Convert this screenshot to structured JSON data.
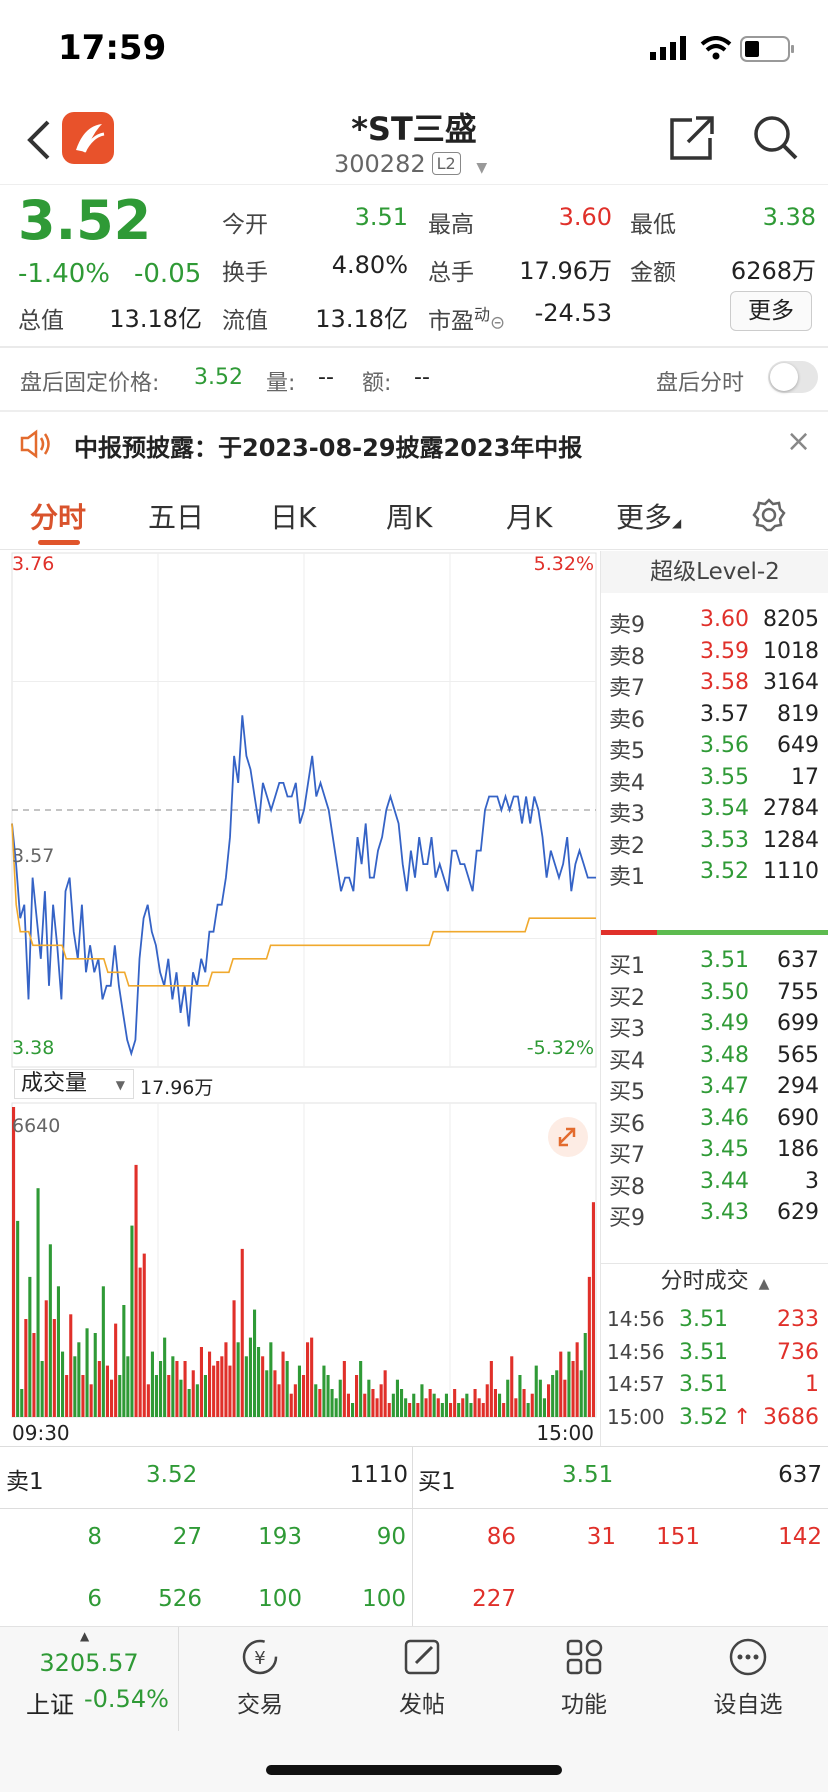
{
  "status_bar": {
    "time": "17:59"
  },
  "header": {
    "title": "*ST三盛",
    "code": "300282",
    "level_badge": "L2"
  },
  "quote": {
    "price": "3.52",
    "change_pct": "-1.40%",
    "change": "-0.05",
    "open_label": "今开",
    "open": "3.51",
    "high_label": "最高",
    "high": "3.60",
    "low_label": "最低",
    "low": "3.38",
    "turnover_label": "换手",
    "turnover": "4.80%",
    "volume_label": "总手",
    "volume": "17.96万",
    "amount_label": "金额",
    "amount": "6268万",
    "mcap_label": "总值",
    "mcap": "13.18亿",
    "float_label": "流值",
    "float": "13.18亿",
    "pe_label": "市盈",
    "pe_sup": "动",
    "pe": "-24.53",
    "more_button": "更多"
  },
  "after_hours": {
    "label": "盘后固定价格:",
    "price": "3.52",
    "vol_label": "量:",
    "vol": "--",
    "amt_label": "额:",
    "amt": "--",
    "toggle_label": "盘后分时"
  },
  "notice": {
    "text": "中报预披露：于2023-08-29披露2023年中报"
  },
  "tabs": [
    "分时",
    "五日",
    "日K",
    "周K",
    "月K",
    "更多"
  ],
  "chart_labels": {
    "y_max": "3.76",
    "y_min": "3.38",
    "pct_max": "5.32%",
    "pct_min": "-5.32%",
    "prev_close": "3.57",
    "volume_selector": "成交量",
    "volume_total": "17.96万",
    "vol_max": "6640",
    "time_start": "09:30",
    "time_end": "15:00"
  },
  "chart_data": {
    "type": "line",
    "title": "",
    "xlabel": "",
    "ylabel": "",
    "x_range": [
      "09:30",
      "15:00"
    ],
    "ylim": [
      3.38,
      3.76
    ],
    "reference_line": 3.57,
    "series": [
      {
        "values": [
          3.56,
          3.53,
          3.49,
          3.5,
          3.43,
          3.52,
          3.49,
          3.46,
          3.51,
          3.44,
          3.5,
          3.47,
          3.43,
          3.51,
          3.52,
          3.48,
          3.46,
          3.5,
          3.45,
          3.47,
          3.45,
          3.46,
          3.43,
          3.44,
          3.44,
          3.47,
          3.44,
          3.42,
          3.4,
          3.39,
          3.4,
          3.46,
          3.49,
          3.5,
          3.48,
          3.47,
          3.45,
          3.44,
          3.46,
          3.43,
          3.45,
          3.42,
          3.44,
          3.41,
          3.45,
          3.44,
          3.46,
          3.45,
          3.48,
          3.48,
          3.5,
          3.5,
          3.52,
          3.55,
          3.61,
          3.59,
          3.64,
          3.61,
          3.6,
          3.58,
          3.56,
          3.59,
          3.58,
          3.57,
          3.58,
          3.59,
          3.59,
          3.58,
          3.58,
          3.59,
          3.56,
          3.57,
          3.59,
          3.61,
          3.58,
          3.59,
          3.58,
          3.57,
          3.55,
          3.53,
          3.51,
          3.52,
          3.52,
          3.51,
          3.55,
          3.53,
          3.56,
          3.52,
          3.52,
          3.54,
          3.55,
          3.57,
          3.58,
          3.57,
          3.56,
          3.53,
          3.51,
          3.54,
          3.52,
          3.55,
          3.53,
          3.53,
          3.55,
          3.52,
          3.53,
          3.52,
          3.51,
          3.54,
          3.54,
          3.53,
          3.53,
          3.52,
          3.51,
          3.54,
          3.54,
          3.57,
          3.58,
          3.58,
          3.58,
          3.57,
          3.58,
          3.57,
          3.58,
          3.58,
          3.56,
          3.58,
          3.56,
          3.58,
          3.57,
          3.55,
          3.52,
          3.54,
          3.53,
          3.52,
          3.53,
          3.55,
          3.51,
          3.53,
          3.54,
          3.53,
          3.52,
          3.52,
          3.52
        ]
      },
      {
        "values": [
          3.56,
          3.5,
          3.48,
          3.48,
          3.48,
          3.47,
          3.47,
          3.47,
          3.47,
          3.47,
          3.47,
          3.47,
          3.47,
          3.46,
          3.46,
          3.46,
          3.46,
          3.46,
          3.46,
          3.46,
          3.46,
          3.46,
          3.46,
          3.45,
          3.45,
          3.45,
          3.45,
          3.45,
          3.44,
          3.44,
          3.44,
          3.44,
          3.44,
          3.44,
          3.44,
          3.44,
          3.44,
          3.44,
          3.44,
          3.44,
          3.44,
          3.44,
          3.44,
          3.44,
          3.44,
          3.44,
          3.44,
          3.44,
          3.45,
          3.45,
          3.45,
          3.45,
          3.45,
          3.46,
          3.46,
          3.46,
          3.46,
          3.46,
          3.46,
          3.46,
          3.46,
          3.46,
          3.47,
          3.47,
          3.47,
          3.47,
          3.47,
          3.47,
          3.47,
          3.47,
          3.47,
          3.47,
          3.47,
          3.47,
          3.47,
          3.47,
          3.47,
          3.47,
          3.47,
          3.47,
          3.47,
          3.47,
          3.47,
          3.47,
          3.47,
          3.47,
          3.47,
          3.47,
          3.47,
          3.47,
          3.47,
          3.47,
          3.47,
          3.47,
          3.47,
          3.47,
          3.47,
          3.47,
          3.47,
          3.47,
          3.47,
          3.48,
          3.48,
          3.48,
          3.48,
          3.48,
          3.48,
          3.48,
          3.48,
          3.48,
          3.48,
          3.48,
          3.48,
          3.48,
          3.48,
          3.48,
          3.48,
          3.48,
          3.48,
          3.48,
          3.48,
          3.48,
          3.48,
          3.48,
          3.49,
          3.49,
          3.49,
          3.49,
          3.49,
          3.49,
          3.49,
          3.49,
          3.49,
          3.49,
          3.49,
          3.49,
          3.49,
          3.49,
          3.49,
          3.49,
          3.49
        ]
      }
    ],
    "volume": [
      6640,
      4200,
      600,
      2100,
      3000,
      1800,
      4900,
      1200,
      2500,
      3700,
      2100,
      2800,
      1400,
      900,
      2200,
      1300,
      1600,
      900,
      1900,
      700,
      1800,
      1200,
      2800,
      1100,
      800,
      2000,
      900,
      2400,
      1300,
      4100,
      5400,
      3200,
      3500,
      700,
      1400,
      900,
      1200,
      1700,
      900,
      1300,
      1200,
      800,
      1200,
      600,
      1000,
      700,
      1500,
      900,
      1400,
      1100,
      1200,
      1300,
      1600,
      1100,
      2500,
      1600,
      3600,
      1300,
      1700,
      2300,
      1500,
      1300,
      1000,
      1600,
      1000,
      700,
      1400,
      1200,
      500,
      700,
      1100,
      900,
      1600,
      1700,
      700,
      600,
      1100,
      900,
      600,
      400,
      800,
      1200,
      500,
      300,
      900,
      1200,
      500,
      800,
      600,
      400,
      700,
      1000,
      300,
      500,
      800,
      600,
      400,
      300,
      500,
      300,
      700,
      400,
      600,
      500,
      400,
      300,
      500,
      300,
      600,
      300,
      400,
      500,
      300,
      600,
      400,
      300,
      700,
      1200,
      600,
      500,
      300,
      800,
      1300,
      400,
      900,
      600,
      300,
      500,
      1100,
      800,
      400,
      700,
      900,
      1000,
      1400,
      800,
      1400,
      1200,
      1600,
      1000,
      1800,
      3000,
      4600
    ]
  },
  "order_book": {
    "title": "超级Level-2",
    "asks": [
      {
        "label": "卖9",
        "price": "3.60",
        "qty": "8205"
      },
      {
        "label": "卖8",
        "price": "3.59",
        "qty": "1018"
      },
      {
        "label": "卖7",
        "price": "3.58",
        "qty": "3164"
      },
      {
        "label": "卖6",
        "price": "3.57",
        "qty": "819"
      },
      {
        "label": "卖5",
        "price": "3.56",
        "qty": "649"
      },
      {
        "label": "卖4",
        "price": "3.55",
        "qty": "17"
      },
      {
        "label": "卖3",
        "price": "3.54",
        "qty": "2784"
      },
      {
        "label": "卖2",
        "price": "3.53",
        "qty": "1284"
      },
      {
        "label": "卖1",
        "price": "3.52",
        "qty": "1110"
      }
    ],
    "bids": [
      {
        "label": "买1",
        "price": "3.51",
        "qty": "637"
      },
      {
        "label": "买2",
        "price": "3.50",
        "qty": "755"
      },
      {
        "label": "买3",
        "price": "3.49",
        "qty": "699"
      },
      {
        "label": "买4",
        "price": "3.48",
        "qty": "565"
      },
      {
        "label": "买5",
        "price": "3.47",
        "qty": "294"
      },
      {
        "label": "买6",
        "price": "3.46",
        "qty": "690"
      },
      {
        "label": "买7",
        "price": "3.45",
        "qty": "186"
      },
      {
        "label": "买8",
        "price": "3.44",
        "qty": "3"
      },
      {
        "label": "买9",
        "price": "3.43",
        "qty": "629"
      }
    ],
    "trades_title": "分时成交",
    "trades": [
      {
        "time": "14:56",
        "price": "3.51",
        "qty": "233"
      },
      {
        "time": "14:56",
        "price": "3.51",
        "qty": "736"
      },
      {
        "time": "14:57",
        "price": "3.51",
        "qty": "1"
      },
      {
        "time": "15:00",
        "price": "3.52",
        "qty": "3686",
        "arrow": "↑"
      }
    ]
  },
  "bottom_ticks": {
    "sell_label": "卖1",
    "sell_price": "3.52",
    "sell_qty": "1110",
    "buy_label": "买1",
    "buy_price": "3.51",
    "buy_qty": "637",
    "sell_row1": [
      "8",
      "27",
      "193",
      "90"
    ],
    "sell_row2": [
      "6",
      "526",
      "100",
      "100"
    ],
    "buy_row1": [
      "86",
      "31",
      "151",
      "142"
    ],
    "buy_row2": [
      "227"
    ]
  },
  "tab_bar": {
    "index_value": "3205.57",
    "index_name": "上证",
    "index_change": "-0.54%",
    "items": [
      "交易",
      "发帖",
      "功能",
      "设自选"
    ]
  }
}
